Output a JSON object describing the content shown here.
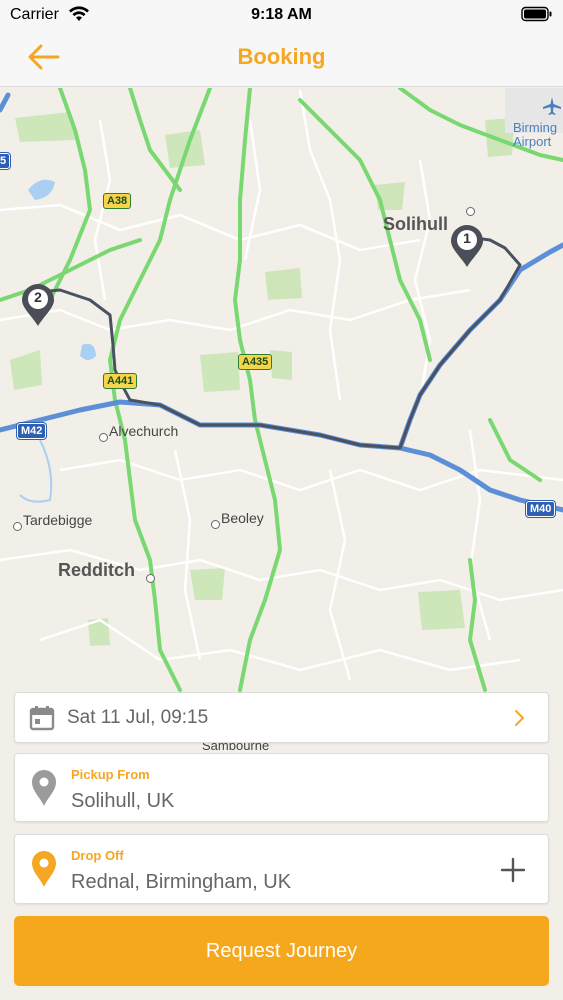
{
  "status_bar": {
    "carrier": "Carrier",
    "time": "9:18 AM"
  },
  "nav": {
    "title": "Booking",
    "back_icon": "arrow-left-icon"
  },
  "colors": {
    "accent": "#f5a623",
    "route": "#4a5160",
    "motorway": "#5b8fd8",
    "a_road": "#6fd66f"
  },
  "map": {
    "places": [
      "Solihull",
      "Redditch",
      "Alvechurch",
      "Tardebigge",
      "Beoley",
      "Sambourne"
    ],
    "airport": [
      "Birming",
      "Airport"
    ],
    "roads": {
      "a38": "A38",
      "a435": "A435",
      "a441": "A441",
      "m42": "M42",
      "m40": "M40",
      "edge": "5"
    },
    "markers": [
      "1",
      "2"
    ]
  },
  "date_card": {
    "icon": "calendar-icon",
    "text": "Sat 11 Jul, 09:15",
    "chevron_icon": "chevron-right-icon"
  },
  "pickup": {
    "icon": "map-pin-icon",
    "label": "Pickup From",
    "value": "Solihull, UK"
  },
  "dropoff": {
    "icon": "map-pin-icon",
    "label": "Drop Off",
    "value": "Rednal, Birmingham, UK",
    "add_icon": "plus-icon"
  },
  "request_button": {
    "label": "Request Journey"
  }
}
